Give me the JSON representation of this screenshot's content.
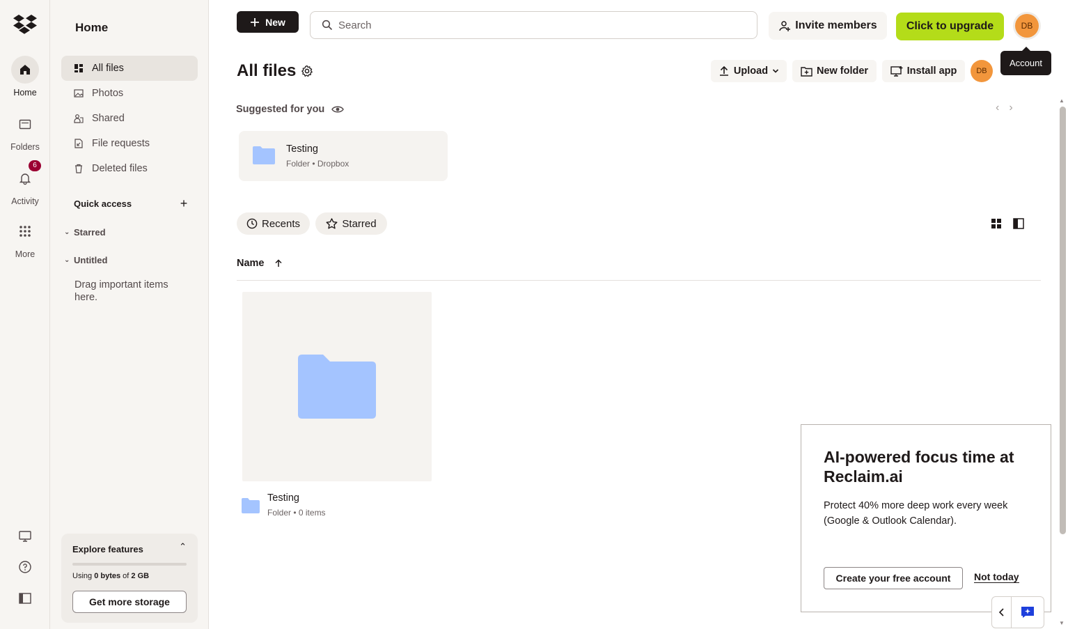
{
  "rail": {
    "items": [
      {
        "label": "Home",
        "icon": "home-icon"
      },
      {
        "label": "Folders",
        "icon": "folders-icon"
      },
      {
        "label": "Activity",
        "icon": "bell-icon",
        "badge": "6"
      },
      {
        "label": "More",
        "icon": "grid-icon"
      }
    ]
  },
  "sidebar": {
    "title": "Home",
    "nav": [
      {
        "label": "All files",
        "icon": "all-files-icon"
      },
      {
        "label": "Photos",
        "icon": "photos-icon"
      },
      {
        "label": "Shared",
        "icon": "shared-icon"
      },
      {
        "label": "File requests",
        "icon": "file-requests-icon"
      },
      {
        "label": "Deleted files",
        "icon": "trash-icon"
      }
    ],
    "quick_access": {
      "title": "Quick access",
      "groups": [
        "Starred",
        "Untitled"
      ],
      "hint": "Drag important items here."
    },
    "explore": {
      "title": "Explore features",
      "usage_prefix": "Using ",
      "usage_bold": "0 bytes",
      "usage_mid": " of ",
      "usage_total": "2 GB",
      "usage_fraction": 0,
      "button": "Get more storage"
    }
  },
  "topbar": {
    "new_label": "New",
    "search_placeholder": "Search",
    "invite_label": "Invite members",
    "upgrade_label": "Click to upgrade",
    "avatar_initials": "DB",
    "tooltip": "Account"
  },
  "page": {
    "title": "All files",
    "upload_label": "Upload",
    "new_folder_label": "New folder",
    "install_label": "Install app",
    "avatar_initials": "DB",
    "suggested_label": "Suggested for you",
    "suggested_item": {
      "name": "Testing",
      "sub": "Folder • Dropbox"
    },
    "chips": [
      "Recents",
      "Starred"
    ],
    "column_name": "Name",
    "item": {
      "name": "Testing",
      "sub": "Folder • 0 items"
    }
  },
  "promo": {
    "heading": "AI-powered focus time at Reclaim.ai",
    "body": "Protect 40% more deep work every week (Google & Outlook Calendar).",
    "cta": "Create your free account",
    "dismiss": "Not today"
  },
  "colors": {
    "accent_upgrade": "#b4dc19",
    "avatar": "#f2963c",
    "folder": "#a4c4ff",
    "badge": "#9b0032",
    "dark": "#1e1919"
  }
}
